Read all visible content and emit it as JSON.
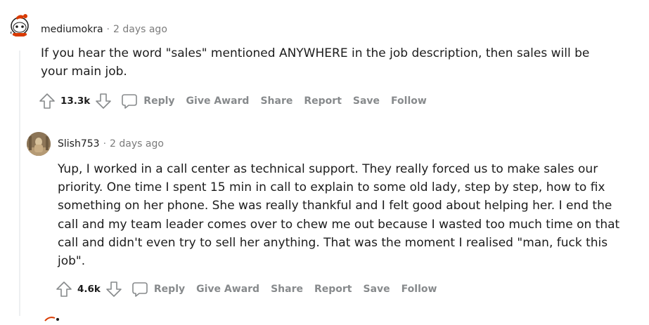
{
  "comments": [
    {
      "username": "mediumokra",
      "separator": "·",
      "time": "2 days ago",
      "body": "If you hear the word \"sales\" mentioned ANYWHERE in the job description, then sales will be your main job.",
      "score": "13.3k",
      "actions": {
        "reply": "Reply",
        "give_award": "Give Award",
        "share": "Share",
        "report": "Report",
        "save": "Save",
        "follow": "Follow"
      }
    },
    {
      "username": "Slish753",
      "separator": "·",
      "time": "2 days ago",
      "body": "Yup, I worked in a call center as technical support. They really forced us to make sales our priority. One time I spent 15 min in call to explain to some old lady, step by step, how to fix something on her phone. She was really thankful and I felt good about helping her. I end the call and my team leader comes over to chew me out because I wasted too much time on that call and didn't even try to sell her anything. That was the moment I realised \"man, fuck this job\".",
      "score": "4.6k",
      "actions": {
        "reply": "Reply",
        "give_award": "Give Award",
        "share": "Share",
        "report": "Report",
        "save": "Save",
        "follow": "Follow"
      }
    }
  ],
  "icons": {
    "upvote": "upvote-arrow-icon",
    "downvote": "downvote-arrow-icon",
    "reply": "speech-bubble-icon"
  },
  "colors": {
    "action_text": "#878a8c",
    "thread_line": "#edeff1"
  }
}
